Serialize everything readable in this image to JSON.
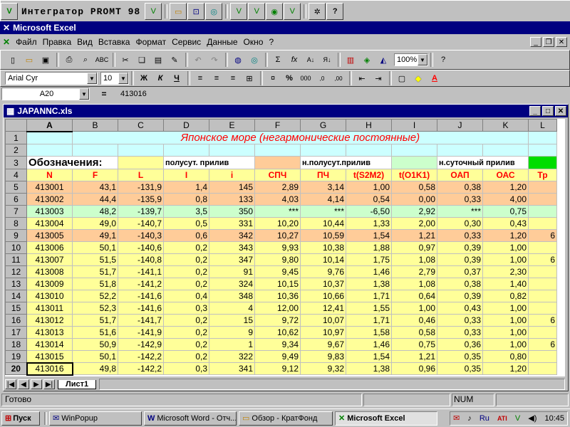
{
  "promt": {
    "title": "Интегратор PROMT 98"
  },
  "excel": {
    "title": "Microsoft Excel"
  },
  "menu": [
    "Файл",
    "Правка",
    "Вид",
    "Вставка",
    "Формат",
    "Сервис",
    "Данные",
    "Окно",
    "?"
  ],
  "toolbar": {
    "zoom": "100%",
    "font": "Arial Cyr",
    "size": "10",
    "bold": "Ж",
    "italic": "К",
    "underline": "Ч",
    "percent": "%",
    "sigma": "Σ",
    "fx": "fx"
  },
  "formula_bar": {
    "cell": "A20",
    "eq": "=",
    "value": "413016"
  },
  "workbook": {
    "title": "JAPANNC.xls"
  },
  "columns": [
    "A",
    "B",
    "C",
    "D",
    "E",
    "F",
    "G",
    "H",
    "I",
    "J",
    "K",
    "L"
  ],
  "sheet": {
    "title": "Японское море (негармонические постоянные)",
    "row3": {
      "a": "Обозначения:",
      "d": "полусут. прилив",
      "g": "н.полусут.прилив",
      "j": "н.суточный прилив"
    },
    "headers": [
      "N",
      "F",
      "L",
      "I",
      "i",
      "СПЧ",
      "ПЧ",
      "t(S2M2)",
      "t(O1K1)",
      "ОАП",
      "ОАС",
      "Тр"
    ],
    "rows": [
      {
        "n": "5",
        "cells": [
          "413001",
          "43,1",
          "-131,9",
          "1,4",
          "145",
          "2,89",
          "3,14",
          "1,00",
          "0,58",
          "0,38",
          "1,20",
          ""
        ]
      },
      {
        "n": "6",
        "cells": [
          "413002",
          "44,4",
          "-135,9",
          "0,8",
          "133",
          "4,03",
          "4,14",
          "0,54",
          "0,00",
          "0,33",
          "4,00",
          ""
        ]
      },
      {
        "n": "7",
        "cells": [
          "413003",
          "48,2",
          "-139,7",
          "3,5",
          "350",
          "***",
          "***",
          "-6,50",
          "2,92",
          "***",
          "0,75",
          ""
        ]
      },
      {
        "n": "8",
        "cells": [
          "413004",
          "49,0",
          "-140,7",
          "0,5",
          "331",
          "10,20",
          "10,44",
          "1,33",
          "2,00",
          "0,30",
          "0,43",
          ""
        ]
      },
      {
        "n": "9",
        "cells": [
          "413005",
          "49,1",
          "-140,3",
          "0,6",
          "342",
          "10,27",
          "10,59",
          "1,54",
          "1,21",
          "0,33",
          "1,20",
          "6"
        ]
      },
      {
        "n": "10",
        "cells": [
          "413006",
          "50,1",
          "-140,6",
          "0,2",
          "343",
          "9,93",
          "10,38",
          "1,88",
          "0,97",
          "0,39",
          "1,00",
          ""
        ]
      },
      {
        "n": "11",
        "cells": [
          "413007",
          "51,5",
          "-140,8",
          "0,2",
          "347",
          "9,80",
          "10,14",
          "1,75",
          "1,08",
          "0,39",
          "1,00",
          "6"
        ]
      },
      {
        "n": "12",
        "cells": [
          "413008",
          "51,7",
          "-141,1",
          "0,2",
          "91",
          "9,45",
          "9,76",
          "1,46",
          "2,79",
          "0,37",
          "2,30",
          ""
        ]
      },
      {
        "n": "13",
        "cells": [
          "413009",
          "51,8",
          "-141,2",
          "0,2",
          "324",
          "10,15",
          "10,37",
          "1,38",
          "1,08",
          "0,38",
          "1,40",
          ""
        ]
      },
      {
        "n": "14",
        "cells": [
          "413010",
          "52,2",
          "-141,6",
          "0,4",
          "348",
          "10,36",
          "10,66",
          "1,71",
          "0,64",
          "0,39",
          "0,82",
          ""
        ]
      },
      {
        "n": "15",
        "cells": [
          "413011",
          "52,3",
          "-141,6",
          "0,3",
          "4",
          "12,00",
          "12,41",
          "1,55",
          "1,00",
          "0,43",
          "1,00",
          ""
        ]
      },
      {
        "n": "16",
        "cells": [
          "413012",
          "51,7",
          "-141,7",
          "0,2",
          "15",
          "9,72",
          "10,07",
          "1,71",
          "0,46",
          "0,33",
          "1,00",
          "6"
        ]
      },
      {
        "n": "17",
        "cells": [
          "413013",
          "51,6",
          "-141,9",
          "0,2",
          "9",
          "10,62",
          "10,97",
          "1,58",
          "0,58",
          "0,33",
          "1,00",
          ""
        ]
      },
      {
        "n": "18",
        "cells": [
          "413014",
          "50,9",
          "-142,9",
          "0,2",
          "1",
          "9,34",
          "9,67",
          "1,46",
          "0,75",
          "0,36",
          "1,00",
          "6"
        ]
      },
      {
        "n": "19",
        "cells": [
          "413015",
          "50,1",
          "-142,2",
          "0,2",
          "322",
          "9,49",
          "9,83",
          "1,54",
          "1,21",
          "0,35",
          "0,80",
          ""
        ]
      },
      {
        "n": "20",
        "cells": [
          "413016",
          "49,8",
          "-142,2",
          "0,3",
          "341",
          "9,12",
          "9,32",
          "1,38",
          "0,96",
          "0,35",
          "1,20",
          ""
        ]
      }
    ]
  },
  "sheet_tab": "Лист1",
  "status": {
    "ready": "Готово",
    "num": "NUM"
  },
  "taskbar": {
    "start": "Пуск",
    "tasks": [
      "WinPopup",
      "Microsoft Word - Отч...",
      "Обзор - КратФонд",
      "Microsoft Excel"
    ],
    "tray_lang": "Ru",
    "clock": "10:45"
  },
  "colors": {
    "title_bg": "#000080",
    "yellow": "#ffff99",
    "orange": "#ffcc99",
    "green": "#ccffcc",
    "cyan": "#ccffff",
    "red_text": "#ff0000",
    "header_blue": "#000080"
  }
}
